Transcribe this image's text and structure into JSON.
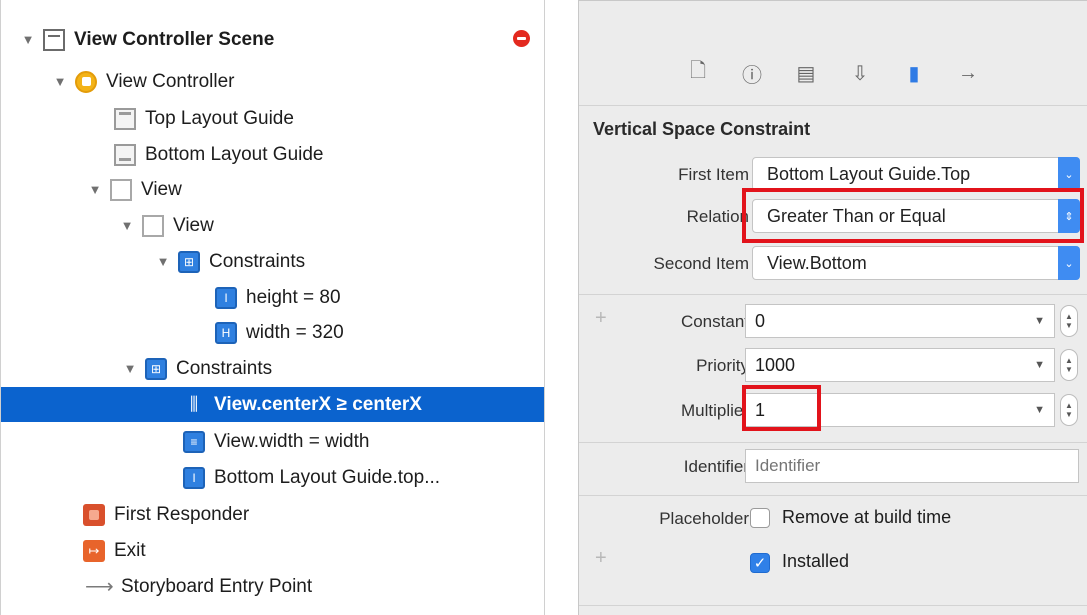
{
  "outline": {
    "scene_title": "View Controller Scene",
    "items": [
      {
        "label": "View Controller"
      },
      {
        "label": "Top Layout Guide"
      },
      {
        "label": "Bottom Layout Guide"
      },
      {
        "label": "View"
      },
      {
        "label": "View"
      },
      {
        "label": "Constraints"
      },
      {
        "label": "height = 80"
      },
      {
        "label": "width = 320"
      },
      {
        "label": "Constraints"
      },
      {
        "label": "View.centerX ≥ centerX"
      },
      {
        "label": "View.width = width"
      },
      {
        "label": "Bottom Layout Guide.top..."
      },
      {
        "label": "First Responder"
      },
      {
        "label": "Exit"
      },
      {
        "label": "Storyboard Entry Point"
      }
    ]
  },
  "inspector": {
    "section_title": "Vertical Space Constraint",
    "first_item": {
      "label": "First Item",
      "value": "Bottom Layout Guide.Top"
    },
    "relation": {
      "label": "Relation",
      "value": "Greater Than or Equal"
    },
    "second_item": {
      "label": "Second Item",
      "value": "View.Bottom"
    },
    "constant": {
      "label": "Constant",
      "value": "0"
    },
    "priority": {
      "label": "Priority",
      "value": "1000"
    },
    "multiplier": {
      "label": "Multiplier",
      "value": "1"
    },
    "identifier": {
      "label": "Identifier",
      "placeholder": "Identifier"
    },
    "placeholder": {
      "label": "Placeholder",
      "checkbox_label": "Remove at build time",
      "checked": false
    },
    "installed": {
      "label": "Installed",
      "checked": true
    }
  },
  "colors": {
    "selection": "#0b63ce",
    "highlight": "#e2131b",
    "accent": "#3f8cf2"
  }
}
